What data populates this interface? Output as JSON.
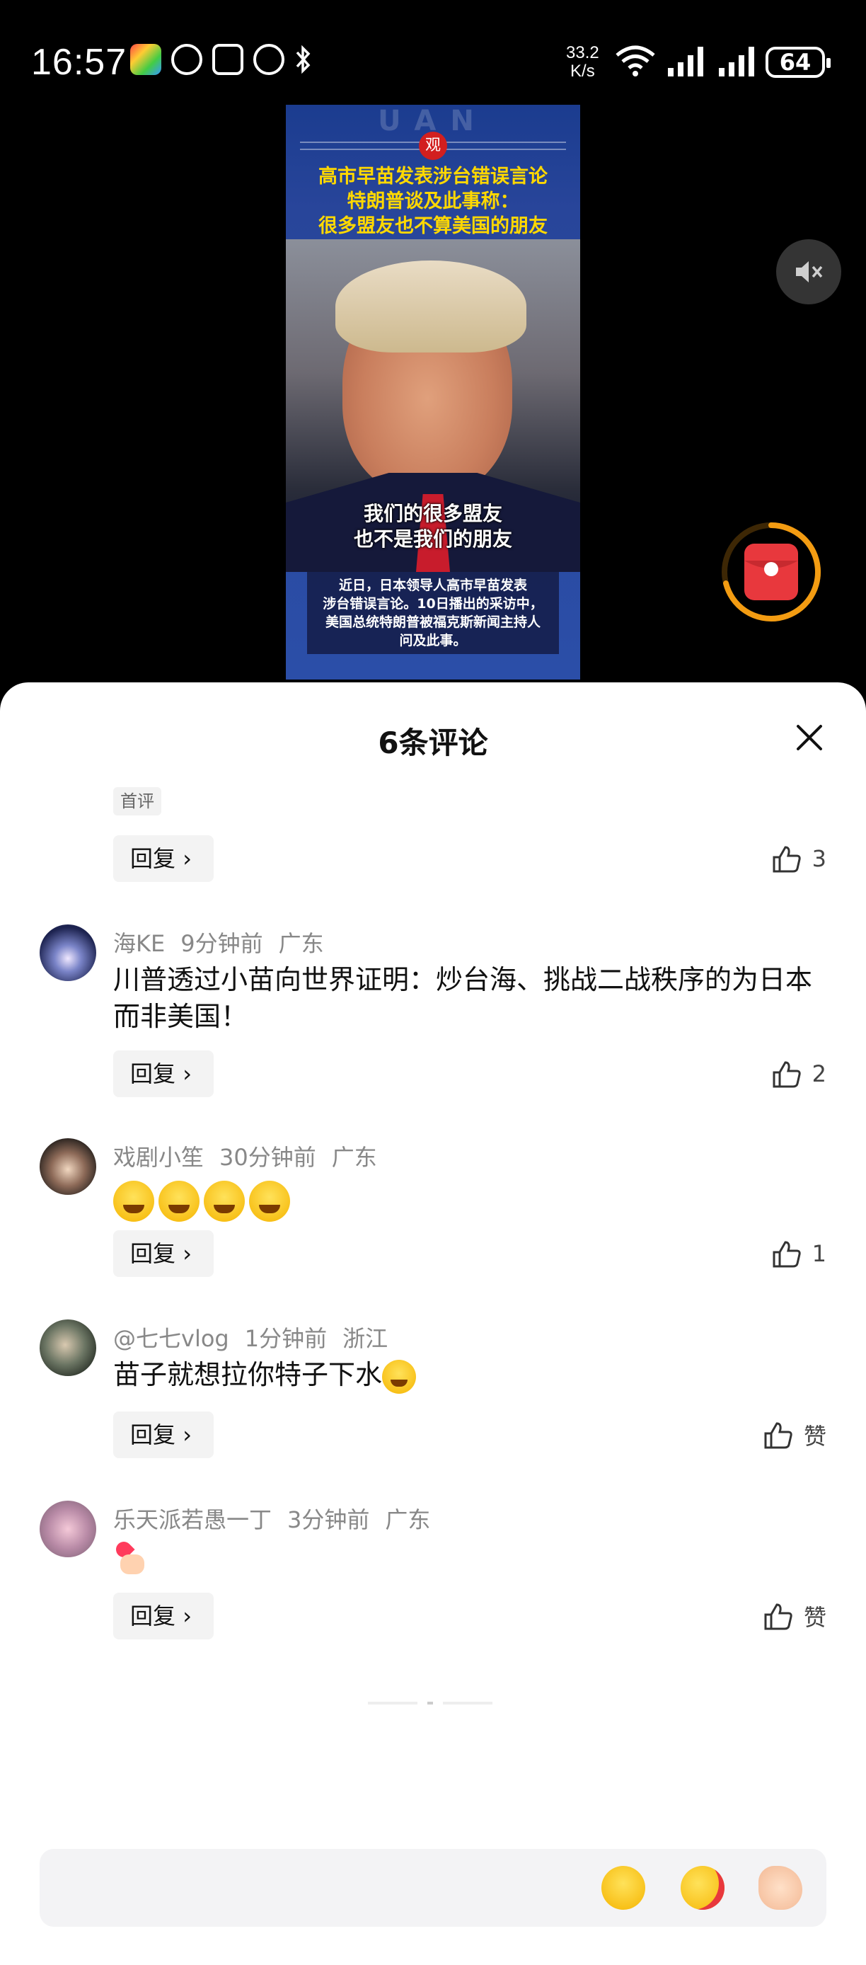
{
  "status_bar": {
    "time": "16:57",
    "net_speed_value": "33.2",
    "net_speed_unit": "K/s",
    "battery": "64",
    "icons": [
      "app-icon",
      "eye-icon",
      "nfc-icon",
      "alarm-icon",
      "bluetooth-icon",
      "wifi-icon",
      "signal-icon",
      "signal-icon",
      "battery-icon"
    ]
  },
  "video": {
    "logo_text": "观",
    "watermark": "UAN",
    "headline_lines": [
      "高市早苗发表涉台错误言论",
      "特朗普谈及此事称：",
      "很多盟友也不算美国的朋友"
    ],
    "subtitle_lines": [
      "我们的很多盟友",
      "也不是我们的朋友"
    ],
    "caption_lines": [
      "近日，日本领导人高市早苗发表",
      "涉台错误言论。10日播出的采访中，",
      "美国总统特朗普被福克斯新闻主持人",
      "问及此事。"
    ],
    "mute_icon": "speaker-muted-icon",
    "red_packet_icon": "red-packet-icon"
  },
  "comments_sheet": {
    "title": "6条评论",
    "close_icon": "close-icon",
    "first_comment_tag": "首评",
    "reply_label": "回复",
    "first_item_likes": "3",
    "comments": [
      {
        "user": "海KE",
        "time": "9分钟前",
        "location": "广东",
        "text": "川普透过小苗向世界证明：炒台海、挑战二战秩序的为日本而非美国！",
        "likes": "2"
      },
      {
        "user": "戏剧小笙",
        "time": "30分钟前",
        "location": "广东",
        "text": "",
        "emojis": [
          "crying-laughing-emoji",
          "crying-emoji",
          "crying-emoji",
          "crying-emoji"
        ],
        "likes": "1"
      },
      {
        "user": "@七七vlog",
        "time": "1分钟前",
        "location": "浙江",
        "text": "苗子就想拉你特子下水",
        "emojis": [
          "crying-laughing-emoji"
        ],
        "likes": "赞"
      },
      {
        "user": "乐天派若愚一丁",
        "time": "3分钟前",
        "location": "广东",
        "text": "",
        "emojis": [
          "finger-heart-emoji"
        ],
        "likes": "赞"
      }
    ]
  },
  "input_bar": {
    "placeholder": "",
    "buttons": [
      "crying-laughing-emoji",
      "rose-kiss-emoji",
      "flexed-biceps-emoji"
    ]
  },
  "colors": {
    "background": "#000000",
    "sheet": "#ffffff",
    "headline_yellow": "#ffd800",
    "red_packet": "#e8383d",
    "ring_orange": "#f39c12"
  }
}
